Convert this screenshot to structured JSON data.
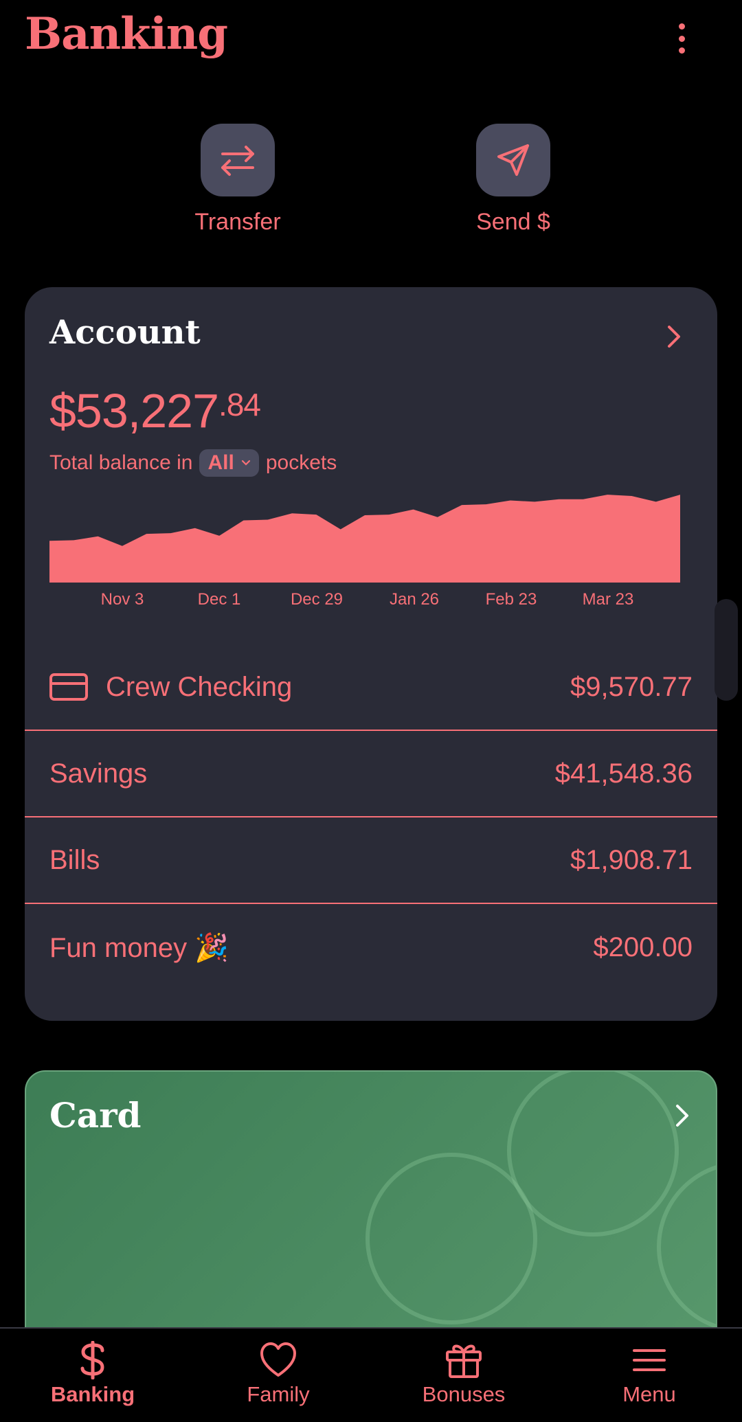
{
  "header": {
    "title": "Banking",
    "more_icon": "more-vertical-icon"
  },
  "actions": [
    {
      "label": "Transfer",
      "icon": "transfer-arrows-icon"
    },
    {
      "label": "Send $",
      "icon": "send-paper-plane-icon"
    }
  ],
  "account": {
    "title": "Account",
    "balance_main": "$53,227",
    "balance_cents": ".84",
    "balance_prefix": "Total balance in",
    "pocket_filter": "All",
    "balance_suffix": "pockets",
    "pockets": [
      {
        "name": "Crew Checking",
        "amount": "$9,570.77",
        "icon": "credit-card-icon"
      },
      {
        "name": "Savings",
        "amount": "$41,548.36"
      },
      {
        "name": "Bills",
        "amount": "$1,908.71"
      },
      {
        "name": "Fun money 🎉",
        "amount": "$200.00"
      }
    ]
  },
  "chart_data": {
    "type": "area",
    "x_ticks": [
      "Nov 3",
      "Dec 1",
      "Dec 29",
      "Jan 26",
      "Feb 23",
      "Mar 23"
    ],
    "values": [
      46500,
      46600,
      47200,
      45700,
      47600,
      47700,
      48500,
      47300,
      49700,
      49800,
      50800,
      50600,
      48300,
      50500,
      50600,
      51400,
      50200,
      52100,
      52200,
      52800,
      52600,
      53000,
      53000,
      53700,
      53500,
      52600,
      53700
    ],
    "color": "#f87077",
    "grid": false
  },
  "card_section": {
    "title": "Card"
  },
  "nav": [
    {
      "label": "Banking",
      "icon": "dollar-icon",
      "active": true
    },
    {
      "label": "Family",
      "icon": "heart-icon",
      "active": false
    },
    {
      "label": "Bonuses",
      "icon": "gift-icon",
      "active": false
    },
    {
      "label": "Menu",
      "icon": "hamburger-menu-icon",
      "active": false
    }
  ],
  "colors": {
    "accent": "#f87077",
    "card_bg": "#2a2b37",
    "green_card": "#4a8a60"
  }
}
